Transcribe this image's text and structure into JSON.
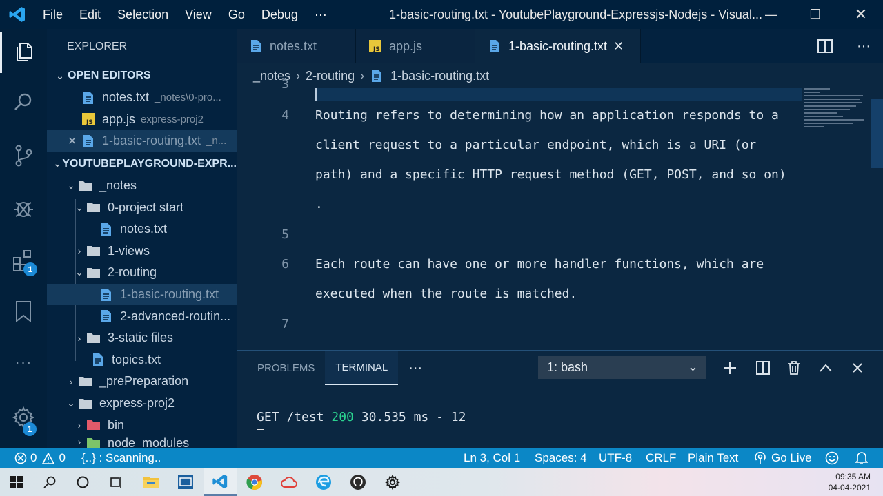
{
  "titlebar": {
    "menu": [
      "File",
      "Edit",
      "Selection",
      "View",
      "Go",
      "Debug",
      "···"
    ],
    "title": "1-basic-routing.txt - YoutubePlayground-Expressjs-Nodejs - Visual...",
    "minimize": "—",
    "restore": "❐",
    "close": "✕"
  },
  "activity": {
    "badge_extensions": "1",
    "badge_settings": "1",
    "more": "···"
  },
  "sidebar": {
    "header": "EXPLORER",
    "open_editors_label": "OPEN EDITORS",
    "open_editors": [
      {
        "name": "notes.txt",
        "hint": "_notes\\0-pro..."
      },
      {
        "name": "app.js",
        "hint": "express-proj2"
      },
      {
        "name": "1-basic-routing.txt",
        "hint": "_n..."
      }
    ],
    "project_label": "YOUTUBEPLAYGROUND-EXPR...",
    "tree": {
      "notes": "_notes",
      "project_start": "0-project start",
      "notes_txt": "notes.txt",
      "views": "1-views",
      "routing": "2-routing",
      "basic_routing": "1-basic-routing.txt",
      "advanced_routing": "2-advanced-routin...",
      "static_files": "3-static files",
      "topics": "topics.txt",
      "preparation": "_prePreparation",
      "express_proj2": "express-proj2",
      "bin": "bin",
      "node_modules": "node_modules"
    }
  },
  "editor": {
    "tabs": [
      {
        "label": "notes.txt"
      },
      {
        "label": "app.js"
      },
      {
        "label": "1-basic-routing.txt",
        "close": "✕"
      }
    ],
    "breadcrumb": [
      "_notes",
      "2-routing",
      "1-basic-routing.txt"
    ],
    "breadcrumb_sep": "›",
    "lines": [
      {
        "num": "3",
        "text": ""
      },
      {
        "num": "4",
        "text": "Routing refers to determining how an application responds to a"
      },
      {
        "num": "",
        "text": "client request to a particular endpoint, which is a URI (or"
      },
      {
        "num": "",
        "text": "path) and a specific HTTP request method (GET, POST, and so on)"
      },
      {
        "num": "",
        "text": "."
      },
      {
        "num": "5",
        "text": ""
      },
      {
        "num": "6",
        "text": "Each route can have one or more handler functions, which are"
      },
      {
        "num": "",
        "text": "executed when the route is matched."
      },
      {
        "num": "7",
        "text": ""
      }
    ]
  },
  "panel": {
    "tabs": [
      "PROBLEMS",
      "TERMINAL"
    ],
    "more": "···",
    "shell": "1: bash",
    "terminal": {
      "request": "GET /test ",
      "status": "200",
      "rest": " 30.535 ms - 12"
    }
  },
  "statusbar": {
    "errors": "0",
    "warnings": "0",
    "scanning": "{..} : Scanning..",
    "position": "Ln 3, Col 1",
    "spaces": "Spaces: 4",
    "encoding": "UTF-8",
    "eol": "CRLF",
    "language": "Plain Text",
    "golive": "Go Live"
  },
  "taskbar": {
    "time": "09:35 AM",
    "date": "04-04-2021"
  },
  "colors": {
    "accent": "#0b87c6",
    "editor_bg": "#0b2741",
    "sidebar_bg": "#03223f",
    "terminal_ok": "#2bd28f"
  }
}
